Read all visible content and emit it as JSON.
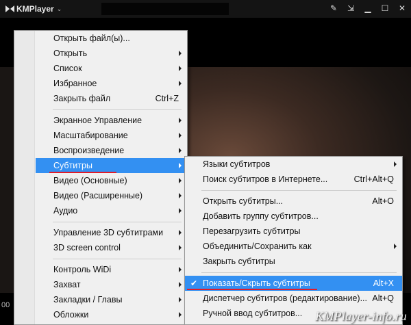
{
  "app": {
    "title": "KMPlayer"
  },
  "time": "00",
  "watermark": "KMPlayer-info.ru",
  "colors": {
    "highlight": "#3390f2",
    "underline": "#e01b2a",
    "titlebar": "#141414"
  },
  "titlebar_icons": [
    "pin-icon",
    "minimize-to-corner-icon",
    "minimize-icon",
    "maximize-icon",
    "close-icon"
  ],
  "main_menu": {
    "items": [
      {
        "label": "Открыть файл(ы)..."
      },
      {
        "label": "Открыть",
        "submenu": true
      },
      {
        "label": "Список",
        "submenu": true
      },
      {
        "label": "Избранное",
        "submenu": true
      },
      {
        "label": "Закрыть файл",
        "shortcut": "Ctrl+Z"
      },
      {
        "separator": true
      },
      {
        "label": "Экранное Управление",
        "submenu": true
      },
      {
        "label": "Масштабирование",
        "submenu": true
      },
      {
        "label": "Воспроизведение",
        "submenu": true
      },
      {
        "label": "Субтитры",
        "submenu": true,
        "highlighted": true
      },
      {
        "label": "Видео (Основные)",
        "submenu": true
      },
      {
        "label": "Видео (Расширенные)",
        "submenu": true
      },
      {
        "label": "Аудио",
        "submenu": true
      },
      {
        "separator": true
      },
      {
        "label": "Управление 3D субтитрами",
        "submenu": true
      },
      {
        "label": "3D screen control",
        "submenu": true
      },
      {
        "separator": true
      },
      {
        "label": "Контроль WiDi",
        "submenu": true
      },
      {
        "label": "Захват",
        "submenu": true
      },
      {
        "label": "Закладки / Главы",
        "submenu": true
      },
      {
        "label": "Обложки",
        "submenu": true
      }
    ]
  },
  "subtitles_menu": {
    "items": [
      {
        "label": "Языки субтитров",
        "submenu": true
      },
      {
        "label": "Поиск субтитров в Интернете...",
        "shortcut": "Ctrl+Alt+Q"
      },
      {
        "separator": true
      },
      {
        "label": "Открыть субтитры...",
        "shortcut": "Alt+O"
      },
      {
        "label": "Добавить группу субтитров..."
      },
      {
        "label": "Перезагрузить субтитры"
      },
      {
        "label": "Объединить/Сохранить как",
        "submenu": true
      },
      {
        "label": "Закрыть субтитры"
      },
      {
        "separator": true
      },
      {
        "label": "Показать/Скрыть субтитры",
        "shortcut": "Alt+X",
        "checked": true,
        "highlighted": true
      },
      {
        "label": "Диспетчер субтитров (редактирование)...",
        "shortcut": "Alt+Q"
      },
      {
        "label": "Ручной ввод субтитров..."
      }
    ]
  }
}
